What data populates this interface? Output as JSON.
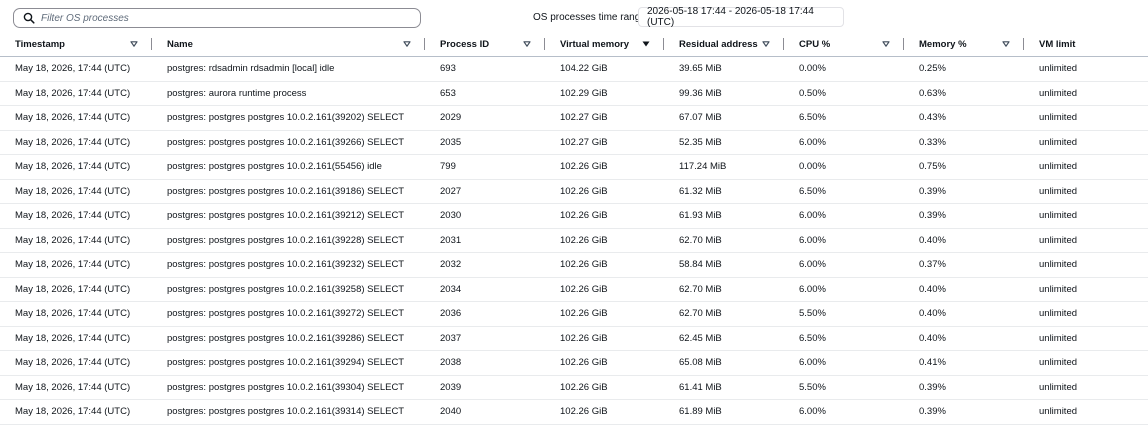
{
  "search": {
    "placeholder": "Filter OS processes",
    "value": ""
  },
  "time_range": {
    "label": "OS processes time range:",
    "value": "2026-05-18 17:44 - 2026-05-18 17:44 (UTC)"
  },
  "table": {
    "columns": [
      {
        "label": "Timestamp",
        "sort_icon": "caret-down-outline-icon"
      },
      {
        "label": "Name",
        "sort_icon": "caret-down-outline-icon"
      },
      {
        "label": "Process ID",
        "sort_icon": "caret-down-outline-icon"
      },
      {
        "label": "Virtual memory",
        "sort_icon": "caret-down-filled-icon"
      },
      {
        "label": "Residual address",
        "sort_icon": "caret-down-outline-icon"
      },
      {
        "label": "CPU %",
        "sort_icon": "caret-down-outline-icon"
      },
      {
        "label": "Memory %",
        "sort_icon": "caret-down-outline-icon"
      },
      {
        "label": "VM limit",
        "sort_icon": ""
      }
    ],
    "rows": [
      [
        "May 18, 2026, 17:44 (UTC)",
        "postgres: rdsadmin rdsadmin [local] idle",
        "693",
        "104.22 GiB",
        "39.65 MiB",
        "0.00%",
        "0.25%",
        "unlimited"
      ],
      [
        "May 18, 2026, 17:44 (UTC)",
        "postgres: aurora runtime process",
        "653",
        "102.29 GiB",
        "99.36 MiB",
        "0.50%",
        "0.63%",
        "unlimited"
      ],
      [
        "May 18, 2026, 17:44 (UTC)",
        "postgres: postgres postgres 10.0.2.161(39202) SELECT",
        "2029",
        "102.27 GiB",
        "67.07 MiB",
        "6.50%",
        "0.43%",
        "unlimited"
      ],
      [
        "May 18, 2026, 17:44 (UTC)",
        "postgres: postgres postgres 10.0.2.161(39266) SELECT",
        "2035",
        "102.27 GiB",
        "52.35 MiB",
        "6.00%",
        "0.33%",
        "unlimited"
      ],
      [
        "May 18, 2026, 17:44 (UTC)",
        "postgres: postgres postgres 10.0.2.161(55456) idle",
        "799",
        "102.26 GiB",
        "117.24 MiB",
        "0.00%",
        "0.75%",
        "unlimited"
      ],
      [
        "May 18, 2026, 17:44 (UTC)",
        "postgres: postgres postgres 10.0.2.161(39186) SELECT",
        "2027",
        "102.26 GiB",
        "61.32 MiB",
        "6.50%",
        "0.39%",
        "unlimited"
      ],
      [
        "May 18, 2026, 17:44 (UTC)",
        "postgres: postgres postgres 10.0.2.161(39212) SELECT",
        "2030",
        "102.26 GiB",
        "61.93 MiB",
        "6.00%",
        "0.39%",
        "unlimited"
      ],
      [
        "May 18, 2026, 17:44 (UTC)",
        "postgres: postgres postgres 10.0.2.161(39228) SELECT",
        "2031",
        "102.26 GiB",
        "62.70 MiB",
        "6.00%",
        "0.40%",
        "unlimited"
      ],
      [
        "May 18, 2026, 17:44 (UTC)",
        "postgres: postgres postgres 10.0.2.161(39232) SELECT",
        "2032",
        "102.26 GiB",
        "58.84 MiB",
        "6.00%",
        "0.37%",
        "unlimited"
      ],
      [
        "May 18, 2026, 17:44 (UTC)",
        "postgres: postgres postgres 10.0.2.161(39258) SELECT",
        "2034",
        "102.26 GiB",
        "62.70 MiB",
        "6.00%",
        "0.40%",
        "unlimited"
      ],
      [
        "May 18, 2026, 17:44 (UTC)",
        "postgres: postgres postgres 10.0.2.161(39272) SELECT",
        "2036",
        "102.26 GiB",
        "62.70 MiB",
        "5.50%",
        "0.40%",
        "unlimited"
      ],
      [
        "May 18, 2026, 17:44 (UTC)",
        "postgres: postgres postgres 10.0.2.161(39286) SELECT",
        "2037",
        "102.26 GiB",
        "62.45 MiB",
        "6.50%",
        "0.40%",
        "unlimited"
      ],
      [
        "May 18, 2026, 17:44 (UTC)",
        "postgres: postgres postgres 10.0.2.161(39294) SELECT",
        "2038",
        "102.26 GiB",
        "65.08 MiB",
        "6.00%",
        "0.41%",
        "unlimited"
      ],
      [
        "May 18, 2026, 17:44 (UTC)",
        "postgres: postgres postgres 10.0.2.161(39304) SELECT",
        "2039",
        "102.26 GiB",
        "61.41 MiB",
        "5.50%",
        "0.39%",
        "unlimited"
      ],
      [
        "May 18, 2026, 17:44 (UTC)",
        "postgres: postgres postgres 10.0.2.161(39314) SELECT",
        "2040",
        "102.26 GiB",
        "61.89 MiB",
        "6.00%",
        "0.39%",
        "unlimited"
      ]
    ]
  }
}
